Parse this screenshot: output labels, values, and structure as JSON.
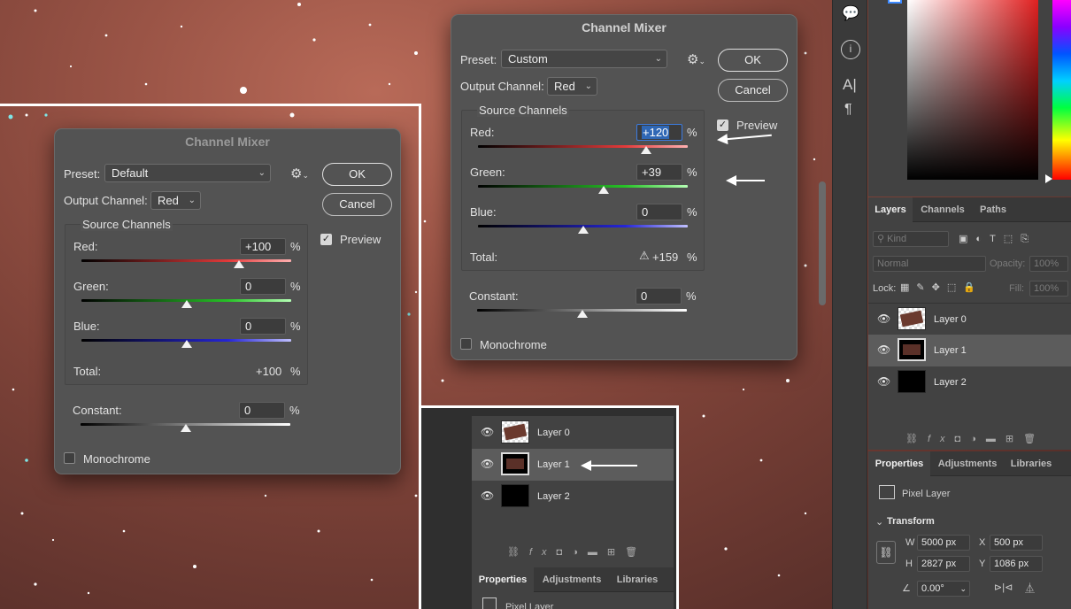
{
  "dialog_right": {
    "title": "Channel Mixer",
    "preset_label": "Preset:",
    "preset_value": "Custom",
    "output_label": "Output Channel:",
    "output_value": "Red",
    "ok": "OK",
    "cancel": "Cancel",
    "preview_label": "Preview",
    "source_channels": "Source Channels",
    "red_label": "Red:",
    "red_value": "+120",
    "green_label": "Green:",
    "green_value": "+39",
    "blue_label": "Blue:",
    "blue_value": "0",
    "total_label": "Total:",
    "total_value": "+159",
    "constant_label": "Constant:",
    "constant_value": "0",
    "monochrome_label": "Monochrome",
    "pct": "%",
    "slider_levels": {
      "red": 0.8,
      "green": 0.6,
      "blue": 0.5,
      "constant": 0.5
    }
  },
  "dialog_left": {
    "title": "Channel Mixer",
    "preset_label": "Preset:",
    "preset_value": "Default",
    "output_label": "Output Channel:",
    "output_value": "Red",
    "ok": "OK",
    "cancel": "Cancel",
    "preview_label": "Preview",
    "source_channels": "Source Channels",
    "red_label": "Red:",
    "red_value": "+100",
    "green_label": "Green:",
    "green_value": "0",
    "blue_label": "Blue:",
    "blue_value": "0",
    "total_label": "Total:",
    "total_value": "+100",
    "constant_label": "Constant:",
    "constant_value": "0",
    "monochrome_label": "Monochrome",
    "pct": "%",
    "slider_levels": {
      "red": 0.75,
      "green": 0.5,
      "blue": 0.5,
      "constant": 0.5
    }
  },
  "layers_panel": {
    "tabs": [
      "Layers",
      "Channels",
      "Paths"
    ],
    "kind_placeholder": "Kind",
    "blend_mode": "Normal",
    "opacity_label": "Opacity:",
    "opacity_value": "100%",
    "lock_label": "Lock:",
    "fill_label": "Fill:",
    "fill_value": "100%",
    "layers": [
      "Layer 0",
      "Layer 1",
      "Layer 2"
    ]
  },
  "inset_layers": {
    "layers": [
      "Layer 0",
      "Layer 1",
      "Layer 2"
    ],
    "tabs": [
      "Properties",
      "Adjustments",
      "Libraries"
    ],
    "pixel_layer": "Pixel Layer"
  },
  "properties_panel": {
    "tabs": [
      "Properties",
      "Adjustments",
      "Libraries"
    ],
    "pixel_layer": "Pixel Layer",
    "transform": "Transform",
    "w_label": "W",
    "w_value": "5000 px",
    "h_label": "H",
    "h_value": "2827 px",
    "x_label": "X",
    "x_value": "500 px",
    "y_label": "Y",
    "y_value": "1086 px",
    "angle_value": "0.00°"
  },
  "colors": {
    "accent": "#2f67b5",
    "panel": "#424242",
    "dialog": "#535353"
  }
}
